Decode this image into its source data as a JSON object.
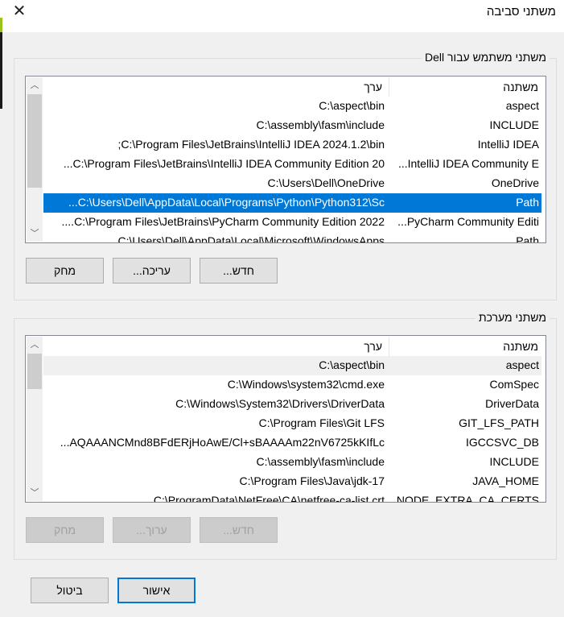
{
  "window": {
    "title": "משתני סביבה",
    "close_icon": "close-icon"
  },
  "user_vars": {
    "label": "משתני משתמש עבור Dell",
    "headers": {
      "name": "משתנה",
      "value": "ערך"
    },
    "rows": [
      {
        "name": "aspect",
        "value": "C:\\aspect\\bin"
      },
      {
        "name": "INCLUDE",
        "value": "C:\\assembly\\fasm\\include"
      },
      {
        "name": "IntelliJ IDEA",
        "value": ";C:\\Program Files\\JetBrains\\IntelliJ IDEA 2024.1.2\\bin"
      },
      {
        "name": "...IntelliJ IDEA Community E",
        "value": "...C:\\Program Files\\JetBrains\\IntelliJ IDEA Community Edition 20"
      },
      {
        "name": "OneDrive",
        "value": "C:\\Users\\Dell\\OneDrive"
      },
      {
        "name": "Path",
        "value": "...C:\\Users\\Dell\\AppData\\Local\\Programs\\Python\\Python312\\Sc",
        "selected": true
      },
      {
        "name": "...PyCharm Community Editi",
        "value": "....C:\\Program Files\\JetBrains\\PyCharm Community Edition 2022"
      },
      {
        "name": "Path",
        "value": "C:\\Users\\Dell\\AppData\\Local\\Microsoft\\WindowsApps"
      }
    ],
    "buttons": {
      "new": "חדש...",
      "edit": "עריכה...",
      "delete": "מחק"
    },
    "scroll_fraction": 0.0
  },
  "system_vars": {
    "label": "משתני מערכת",
    "headers": {
      "name": "משתנה",
      "value": "ערך"
    },
    "rows": [
      {
        "name": "aspect",
        "value": "C:\\aspect\\bin"
      },
      {
        "name": "ComSpec",
        "value": "C:\\Windows\\system32\\cmd.exe"
      },
      {
        "name": "DriverData",
        "value": "C:\\Windows\\System32\\Drivers\\DriverData"
      },
      {
        "name": "GIT_LFS_PATH",
        "value": "C:\\Program Files\\Git LFS"
      },
      {
        "name": "IGCCSVC_DB",
        "value": "...AQAAANCMnd8BFdERjHoAwE/Cl+sBAAAAm22nV6725kKIfLc"
      },
      {
        "name": "INCLUDE",
        "value": "C:\\assembly\\fasm\\include"
      },
      {
        "name": "JAVA_HOME",
        "value": "C:\\Program Files\\Java\\jdk-17"
      },
      {
        "name": "NODE_EXTRA_CA_CERTS",
        "value": "C:\\ProgramData\\NetFree\\CA\\netfree-ca-list.crt"
      }
    ],
    "buttons": {
      "new": "חדש...",
      "edit": "ערוך...",
      "delete": "מחק"
    }
  },
  "footer": {
    "ok": "אישור",
    "cancel": "ביטול"
  }
}
